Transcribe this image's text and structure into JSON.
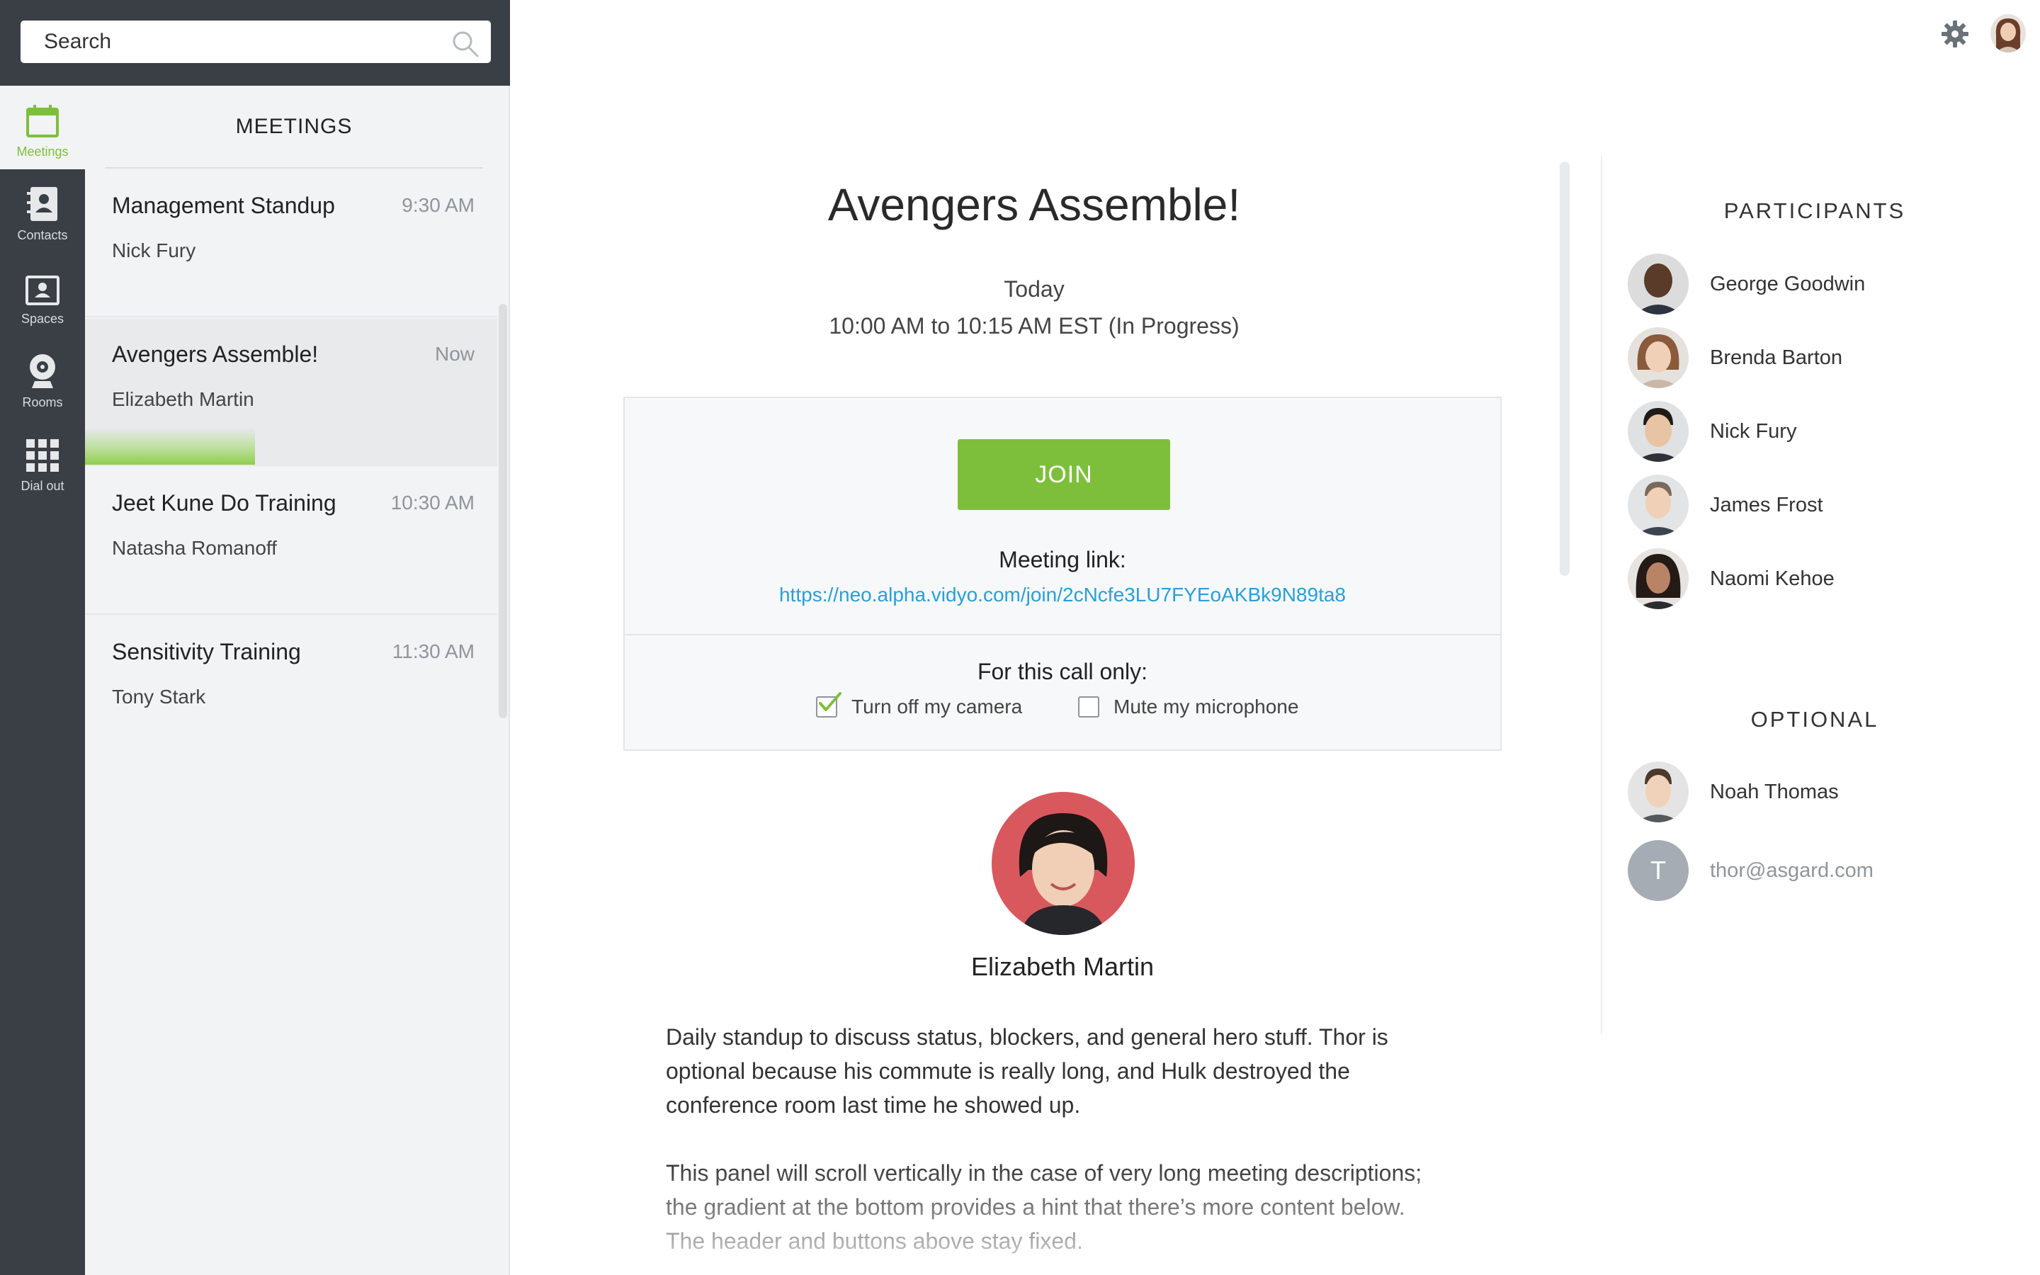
{
  "search": {
    "placeholder": "Search"
  },
  "rail": [
    {
      "label": "Meetings",
      "icon": "calendar-icon",
      "active": true
    },
    {
      "label": "Contacts",
      "icon": "contacts-icon",
      "active": false
    },
    {
      "label": "Spaces",
      "icon": "spaces-icon",
      "active": false
    },
    {
      "label": "Rooms",
      "icon": "webcam-icon",
      "active": false
    },
    {
      "label": "Dial out",
      "icon": "keypad-icon",
      "active": false
    }
  ],
  "meetings_list": {
    "title": "MEETINGS",
    "items": [
      {
        "name": "Management Standup",
        "time": "9:30 AM",
        "organizer": "Nick Fury"
      },
      {
        "name": "Avengers Assemble!",
        "time": "Now",
        "organizer": "Elizabeth Martin"
      },
      {
        "name": "Jeet Kune Do Training",
        "time": "10:30 AM",
        "organizer": "Natasha Romanoff"
      },
      {
        "name": "Sensitivity Training",
        "time": "11:30 AM",
        "organizer": "Tony Stark"
      }
    ]
  },
  "detail": {
    "title": "Avengers Assemble!",
    "day": "Today",
    "time_range": "10:00 AM to 10:15 AM EST (In Progress)",
    "join_label": "JOIN",
    "link_label": "Meeting link:",
    "link_url": "https://neo.alpha.vidyo.com/join/2cNcfe3LU7FYEoAKBk9N89ta8",
    "call_only_label": "For this call only:",
    "camera_option": "Turn off my camera",
    "camera_checked": true,
    "mic_option": "Mute my microphone",
    "mic_checked": false,
    "host_name": "Elizabeth Martin",
    "description_1": "Daily standup to discuss status, blockers, and general hero stuff. Thor is optional because his commute is really long, and Hulk destroyed the conference room last time he showed up.",
    "description_2": "This panel will scroll vertically in the case of very long meeting descriptions; the gradient at the bottom provides a hint that there’s more content below. The header and buttons above stay fixed."
  },
  "participants": {
    "heading": "PARTICIPANTS",
    "people": [
      "George Goodwin",
      "Brenda Barton",
      "Nick Fury",
      "James Frost",
      "Naomi Kehoe"
    ]
  },
  "optional": {
    "heading": "OPTIONAL",
    "people": [
      "Noah Thomas"
    ],
    "email_initial": "T",
    "email": "thor@asgard.com"
  },
  "colors": {
    "accent_green": "#7dbf3b",
    "link_blue": "#2a9fd6",
    "rail_dark": "#3a3f45",
    "list_bg": "#f2f3f4"
  }
}
